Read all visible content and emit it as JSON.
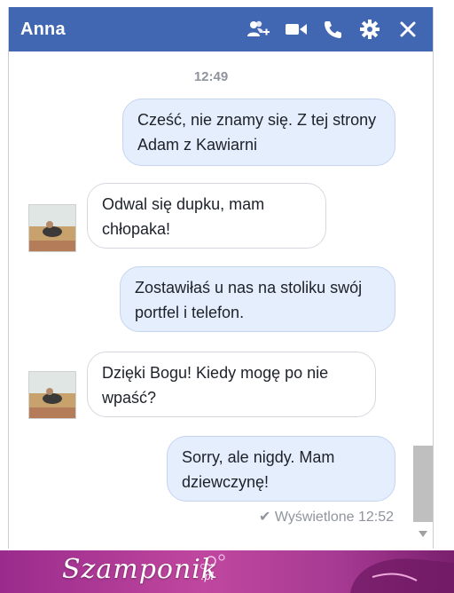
{
  "header": {
    "title": "Anna",
    "icons": [
      "add-person-icon",
      "video-call-icon",
      "phone-icon",
      "gear-icon",
      "close-icon"
    ]
  },
  "conversation": {
    "timestamp": "12:49",
    "messages": [
      {
        "side": "out",
        "text": "Cześć, nie znamy się. Z tej strony Adam z Kawiarni"
      },
      {
        "side": "in",
        "text": "Odwal się dupku, mam chłopaka!"
      },
      {
        "side": "out",
        "text": "Zostawiłaś u nas na stoliku swój portfel i telefon."
      },
      {
        "side": "in",
        "text": "Dzięki Bogu! Kiedy mogę po nie wpaść?"
      },
      {
        "side": "out",
        "text": "Sorry, ale nigdy. Mam dziewczynę!"
      }
    ],
    "seen_status": "✔ Wyświetlone 12:52"
  },
  "colors": {
    "header_bg": "#4267b2",
    "outgoing_bubble": "#e5eefc",
    "incoming_bubble": "#ffffff",
    "banner": "#b03f9a"
  },
  "watermark": {
    "brand": "Szamponik",
    "tld": ".pl"
  }
}
